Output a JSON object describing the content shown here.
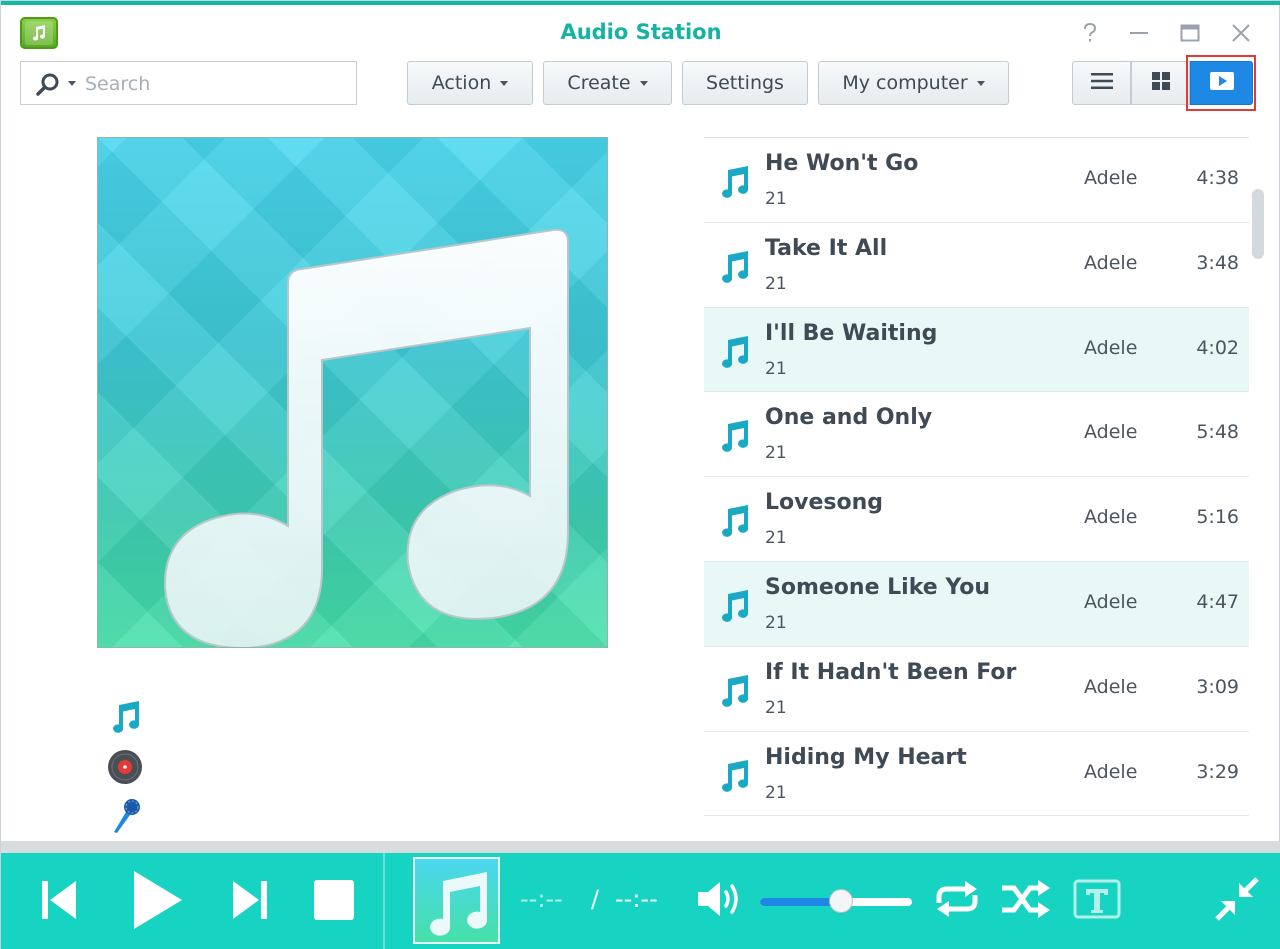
{
  "window": {
    "title": "Audio Station",
    "controls": [
      "help-icon",
      "minimize-icon",
      "maximize-icon",
      "close-icon"
    ]
  },
  "toolbar": {
    "search_placeholder": "Search",
    "search_value": "",
    "buttons": [
      {
        "label": "Action",
        "dropdown": true
      },
      {
        "label": "Create",
        "dropdown": true
      },
      {
        "label": "Settings",
        "dropdown": false
      },
      {
        "label": "My computer",
        "dropdown": true
      }
    ],
    "view_modes": [
      "list-view-icon",
      "grid-view-icon",
      "now-playing-view-icon"
    ],
    "active_view": "now-playing-view-icon"
  },
  "now_playing": {
    "info_icons": [
      "song-icon",
      "album-icon",
      "artist-icon"
    ]
  },
  "tracks": [
    {
      "title": "He Won't Go",
      "album": "21",
      "artist": "Adele",
      "duration": "4:38"
    },
    {
      "title": "Take It All",
      "album": "21",
      "artist": "Adele",
      "duration": "3:48"
    },
    {
      "title": "I'll Be Waiting",
      "album": "21",
      "artist": "Adele",
      "duration": "4:02"
    },
    {
      "title": "One and Only",
      "album": "21",
      "artist": "Adele",
      "duration": "5:48"
    },
    {
      "title": "Lovesong",
      "album": "21",
      "artist": "Adele",
      "duration": "5:16"
    },
    {
      "title": "Someone Like You",
      "album": "21",
      "artist": "Adele",
      "duration": "4:47"
    },
    {
      "title": "If It Hadn't Been For",
      "album": "21",
      "artist": "Adele",
      "duration": "3:09"
    },
    {
      "title": "Hiding My Heart",
      "album": "21",
      "artist": "Adele",
      "duration": "3:29"
    }
  ],
  "highlighted_rows": [
    2,
    5
  ],
  "player": {
    "current_time": "--:--",
    "separator": "/",
    "total_time": "--:--",
    "volume": 0.53,
    "colors": {
      "bar": "#17d3c2",
      "accent": "#1e88e5"
    }
  }
}
